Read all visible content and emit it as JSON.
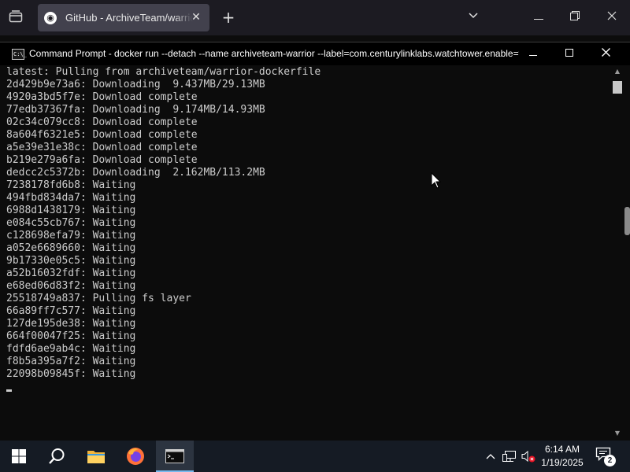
{
  "browser": {
    "tab_title": "GitHub - ArchiveTeam/warrior-dockerfile",
    "favicon_glyph": "◉",
    "close_glyph": "✕",
    "new_tab_glyph": "+",
    "list_tabs_glyph": "⌄",
    "minimize_glyph": "—",
    "maximize_glyph": "❐",
    "window_close_glyph": "✕"
  },
  "cmd": {
    "title": "Command Prompt - docker  run --detach  --name archiveteam-warrior  --label=com.centurylinklabs.watchtower.enable=true",
    "icon_text": "C:\\_",
    "minimize_glyph": "—",
    "maximize_glyph": "☐",
    "close_glyph": "✕",
    "lines": [
      "latest: Pulling from archiveteam/warrior-dockerfile",
      "2d429b9e73a6: Downloading  9.437MB/29.13MB",
      "4920a3bd5f7e: Download complete",
      "77edb37367fa: Downloading  9.174MB/14.93MB",
      "02c34c079cc8: Download complete",
      "8a604f6321e5: Download complete",
      "a5e39e31e38c: Download complete",
      "b219e279a6fa: Download complete",
      "dedcc2c5372b: Downloading  2.162MB/113.2MB",
      "7238178fd6b8: Waiting",
      "494fbd834da7: Waiting",
      "6988d1438179: Waiting",
      "e084c55cb767: Waiting",
      "c128698efa79: Waiting",
      "a052e6689660: Waiting",
      "9b17330e05c5: Waiting",
      "a52b16032fdf: Waiting",
      "e68ed06d83f2: Waiting",
      "25518749a837: Pulling fs layer",
      "66a89ff7c577: Waiting",
      "127de195de38: Waiting",
      "664f00047f25: Waiting",
      "fdfd6ae9ab4c: Waiting",
      "f8b5a395a7f2: Waiting",
      "22098b09845f: Waiting"
    ]
  },
  "taskbar": {
    "time": "6:14 AM",
    "date": "1/19/2025",
    "notification_count": "2",
    "tray_chevron_glyph": "∧",
    "volume_glyph": "🔇"
  },
  "colors": {
    "console_bg": "#0c0c0c",
    "console_text": "#cccccc",
    "taskbar_bg": "#151b24",
    "accent": "#76b9ed",
    "firefox_orange": "#ff7139"
  }
}
